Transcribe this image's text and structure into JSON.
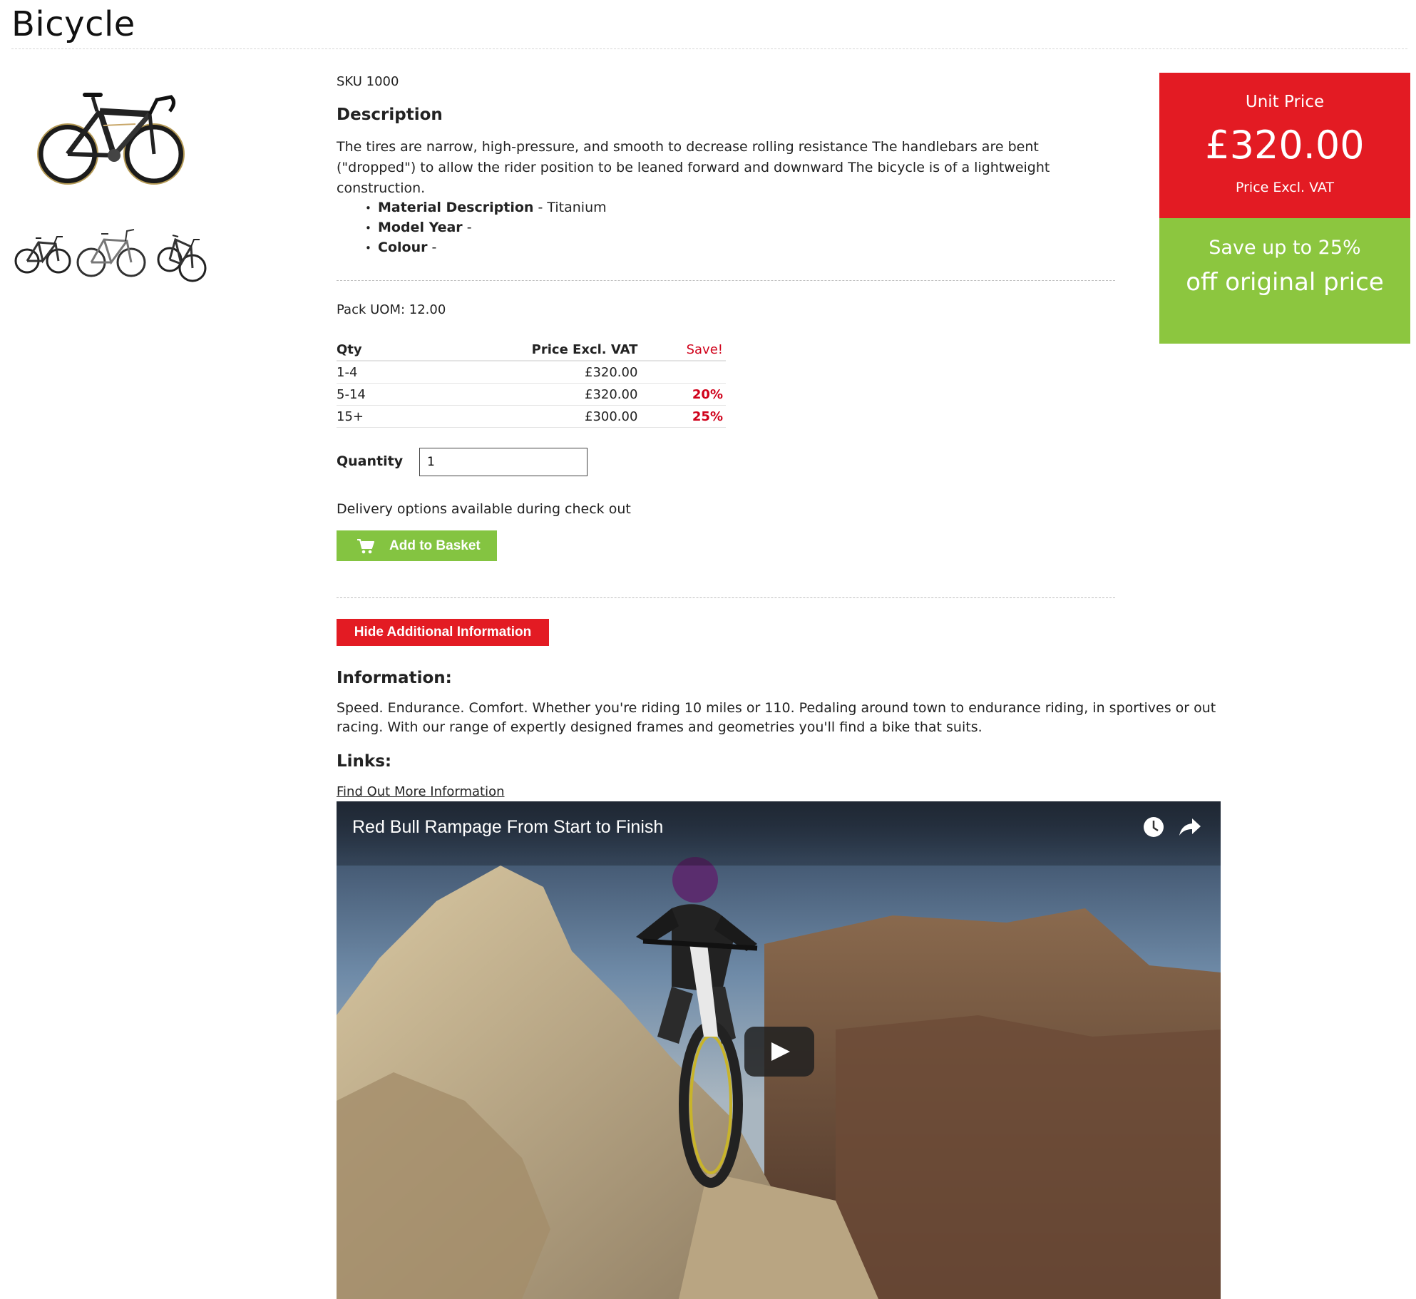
{
  "product": {
    "title": "Bicycle",
    "sku": "SKU 1000",
    "description_heading": "Description",
    "description": "The tires are narrow, high-pressure, and smooth to decrease rolling resistance The handlebars are bent (\"dropped\") to allow the rider position to be leaned forward and downward The bicycle is of a lightweight construction.",
    "attributes": [
      {
        "label": "Material Description",
        "value": "- Titanium"
      },
      {
        "label": "Model Year",
        "value": "-"
      },
      {
        "label": "Colour",
        "value": "-"
      }
    ],
    "pack_uom": "Pack UOM: 12.00"
  },
  "pricing_table": {
    "headers": {
      "qty": "Qty",
      "price": "Price Excl. VAT",
      "save": "Save!"
    },
    "rows": [
      {
        "qty": "1-4",
        "price": "£320.00",
        "save": ""
      },
      {
        "qty": "5-14",
        "price": "£320.00",
        "save": "20%"
      },
      {
        "qty": "15+",
        "price": "£300.00",
        "save": "25%"
      }
    ]
  },
  "order": {
    "quantity_label": "Quantity",
    "quantity_value": "1",
    "delivery_note": "Delivery options available during check out",
    "add_button": "Add to Basket",
    "hide_info_button": "Hide Additional Information"
  },
  "info": {
    "heading": "Information:",
    "text": "Speed. Endurance. Comfort. Whether you're riding 10 miles or 110. Pedaling around town to endurance riding, in sportives or out racing. With our range of expertly designed frames and geometries you'll find a bike that suits.",
    "links_heading": "Links:",
    "link_text": "Find Out More Information"
  },
  "video": {
    "title": "Red Bull Rampage From Start to Finish",
    "icons": [
      "clock-icon",
      "share-icon",
      "play-icon"
    ]
  },
  "price_panel": {
    "unit_label": "Unit Price",
    "unit_price": "£320.00",
    "unit_sub": "Price Excl. VAT",
    "save_line1": "Save up to 25%",
    "save_line2": "off original price"
  },
  "colors": {
    "red": "#e31b23",
    "green": "#84c441",
    "save_text": "#d0021b"
  }
}
